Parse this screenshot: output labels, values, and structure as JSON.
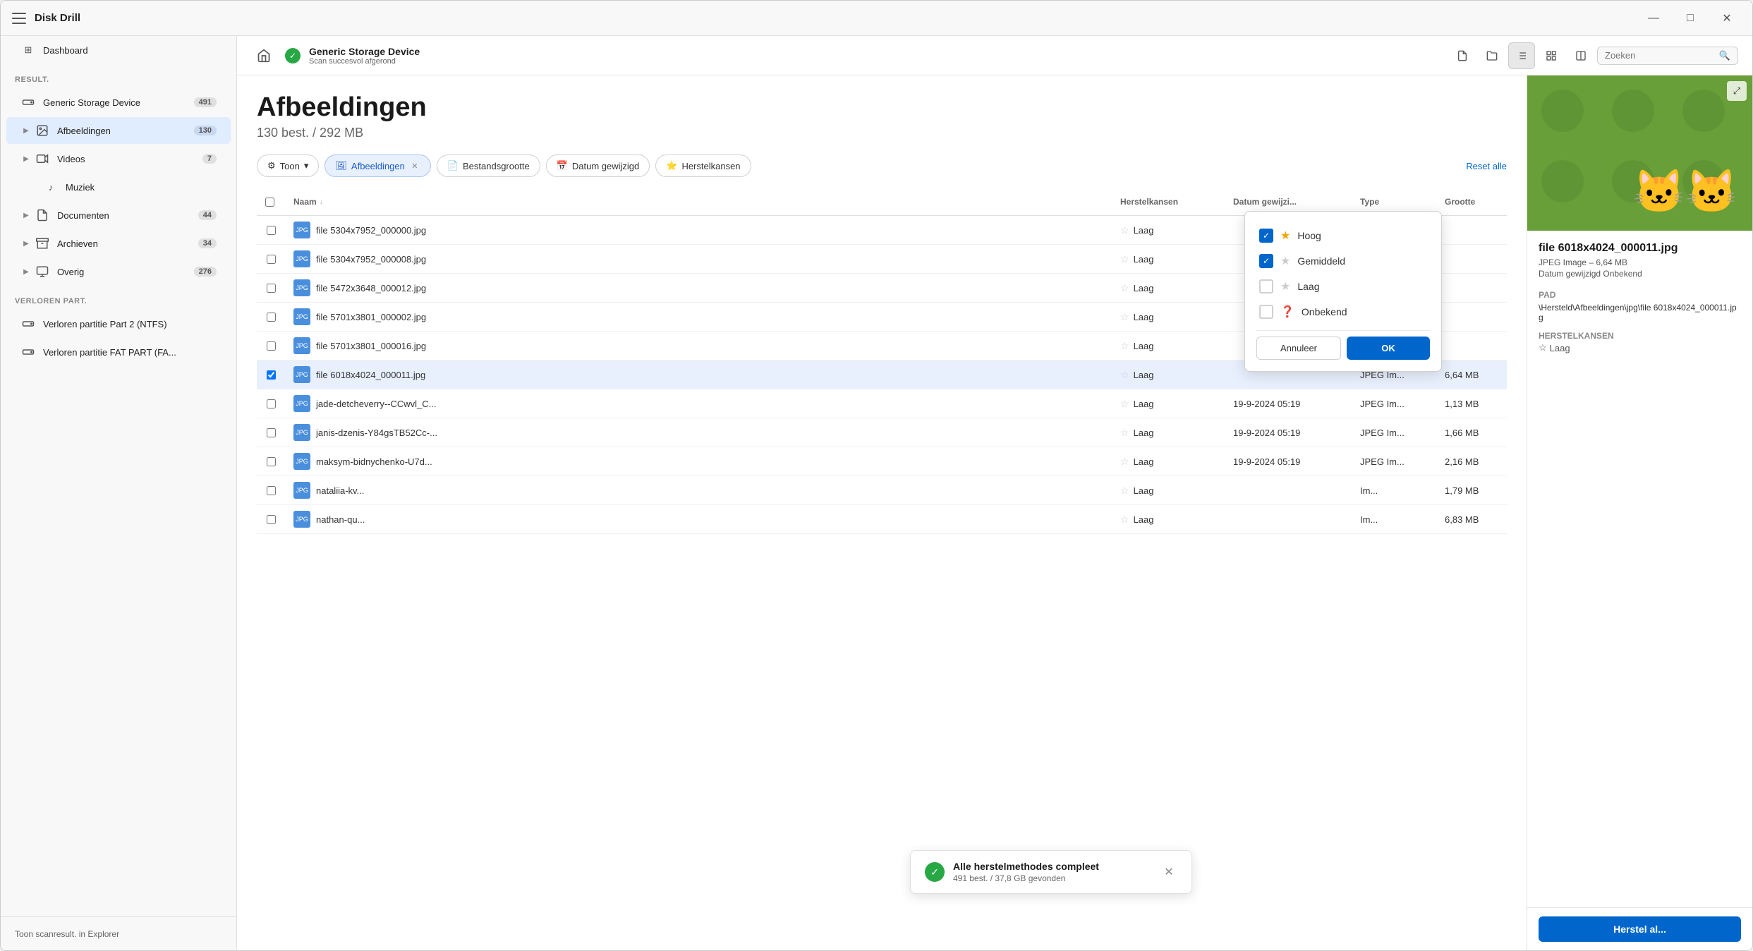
{
  "window": {
    "title": "Disk Drill"
  },
  "titlebar": {
    "app_name": "Disk Drill",
    "minimize": "—",
    "maximize": "□",
    "close": "✕"
  },
  "sidebar": {
    "result_label": "Result.",
    "dashboard_label": "Dashboard",
    "device_label": "Generic Storage Device",
    "device_count": "491",
    "afbeeldingen_label": "Afbeeldingen",
    "afbeeldingen_count": "130",
    "videos_label": "Videos",
    "videos_count": "7",
    "muziek_label": "Muziek",
    "documenten_label": "Documenten",
    "documenten_count": "44",
    "archieven_label": "Archieven",
    "archieven_count": "34",
    "overig_label": "Overig",
    "overig_count": "276",
    "verloren_label": "Verloren part.",
    "verloren_partitie1": "Verloren partitie Part 2 (NTFS)",
    "verloren_partitie2": "Verloren partitie FAT PART (FA...",
    "footer_text": "Toon scanresult. in Explorer"
  },
  "device_bar": {
    "title": "Generic Storage Device",
    "subtitle": "Scan succesvol afgerond",
    "search_placeholder": "Zoeken"
  },
  "page": {
    "title": "Afbeeldingen",
    "subtitle": "130 best. / 292 MB"
  },
  "filters": {
    "toon_label": "Toon",
    "afbeeldingen_label": "Afbeeldingen",
    "bestandsgrootte_label": "Bestandsgrootte",
    "datum_label": "Datum gewijzigd",
    "herstelkansen_label": "Herstelkansen",
    "reset_label": "Reset alle"
  },
  "table": {
    "col_naam": "Naam",
    "col_herstelkansen": "Herstelkansen",
    "col_datum": "Datum gewijzi...",
    "col_type": "Type",
    "col_size": "Grootte",
    "rows": [
      {
        "name": "file 5304x7952_000000.jpg",
        "recovery": "Laag",
        "datum": "",
        "type": "",
        "size": ""
      },
      {
        "name": "file 5304x7952_000008.jpg",
        "recovery": "Laag",
        "datum": "",
        "type": "",
        "size": ""
      },
      {
        "name": "file 5472x3648_000012.jpg",
        "recovery": "Laag",
        "datum": "",
        "type": "",
        "size": ""
      },
      {
        "name": "file 5701x3801_000002.jpg",
        "recovery": "Laag",
        "datum": "",
        "type": "",
        "size": ""
      },
      {
        "name": "file 5701x3801_000016.jpg",
        "recovery": "Laag",
        "datum": "",
        "type": "",
        "size": ""
      },
      {
        "name": "file 6018x4024_000011.jpg",
        "recovery": "Laag",
        "datum": "",
        "type": "JPEG Im...",
        "size": "6,64 MB",
        "selected": true
      },
      {
        "name": "jade-detcheverry--CCwvl_C...",
        "recovery": "Laag",
        "datum": "19-9-2024 05:19",
        "type": "JPEG Im...",
        "size": "1,13 MB"
      },
      {
        "name": "janis-dzenis-Y84gsTB52Cc-...",
        "recovery": "Laag",
        "datum": "19-9-2024 05:19",
        "type": "JPEG Im...",
        "size": "1,66 MB"
      },
      {
        "name": "maksym-bidnychenko-U7d...",
        "recovery": "Laag",
        "datum": "19-9-2024 05:19",
        "type": "JPEG Im...",
        "size": "2,16 MB"
      },
      {
        "name": "nataliia-kv...",
        "recovery": "Laag",
        "datum": "",
        "type": "Im...",
        "size": "1,79 MB"
      },
      {
        "name": "nathan-qu...",
        "recovery": "Laag",
        "datum": "",
        "type": "Im...",
        "size": "6,83 MB"
      }
    ]
  },
  "preview": {
    "filename": "file 6018x4024_000011.jpg",
    "meta1": "JPEG Image – 6,64 MB",
    "meta2": "Datum gewijzigd Onbekend",
    "pad_label": "Pad",
    "pad_value": "\\Hersteld\\Afbeeldingen\\jpg\\file 6018x4024_000011.jpg",
    "herstelkansen_label": "Herstelkansen",
    "herstelkansen_value": "Laag",
    "restore_btn": "Herstel al..."
  },
  "dropdown": {
    "hoog_label": "Hoog",
    "gemiddeld_label": "Gemiddeld",
    "laag_label": "Laag",
    "onbekend_label": "Onbekend",
    "cancel_label": "Annuleer",
    "ok_label": "OK",
    "hoog_checked": true,
    "gemiddeld_checked": true,
    "laag_checked": false,
    "onbekend_checked": false
  },
  "toast": {
    "title": "Alle herstelmethodes compleet",
    "subtitle": "491 best. / 37,8 GB gevonden"
  }
}
